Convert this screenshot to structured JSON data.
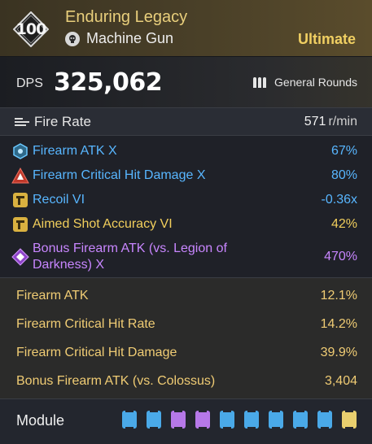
{
  "header": {
    "level": "100",
    "weapon_name": "Enduring Legacy",
    "weapon_type": "Machine Gun",
    "weapon_type_icon": "skull-icon",
    "rarity": "Ultimate",
    "rarity_color": "#f0cf62"
  },
  "dps": {
    "label": "DPS",
    "value": "325,062",
    "ammo_icon": "bullets-icon",
    "ammo_type": "General Rounds"
  },
  "fire_rate": {
    "label": "Fire Rate",
    "value": "571",
    "unit": "r/min"
  },
  "substats": [
    {
      "label": "Firearm ATK X",
      "value": "67%",
      "icon": "hexagon-icon",
      "color": "#58b6ff"
    },
    {
      "label": "Firearm Critical Hit Damage X",
      "value": "80%",
      "icon": "triangle-warning-icon",
      "color": "#58b6ff"
    },
    {
      "label": "Recoil VI",
      "value": "-0.36x",
      "icon": "rifle-badge-icon",
      "color": "#58b6ff"
    },
    {
      "label": "Aimed Shot Accuracy VI",
      "value": "42%",
      "icon": "rifle-badge-icon",
      "color": "#f2cf5c"
    },
    {
      "label": "Bonus Firearm ATK (vs. Legion of Darkness) X",
      "value": "470%",
      "icon": "diamond-icon",
      "color": "#c886ff"
    }
  ],
  "base_stats": [
    {
      "label": "Firearm ATK",
      "value": "12.1%"
    },
    {
      "label": "Firearm Critical Hit Rate",
      "value": "14.2%"
    },
    {
      "label": "Firearm Critical Hit Damage",
      "value": "39.9%"
    },
    {
      "label": "Bonus Firearm ATK (vs. Colossus)",
      "value": "3,404"
    }
  ],
  "module": {
    "label": "Module",
    "sockets": [
      "blue",
      "blue",
      "purple",
      "purple",
      "blue",
      "blue",
      "blue",
      "blue",
      "blue",
      "yellow"
    ]
  }
}
